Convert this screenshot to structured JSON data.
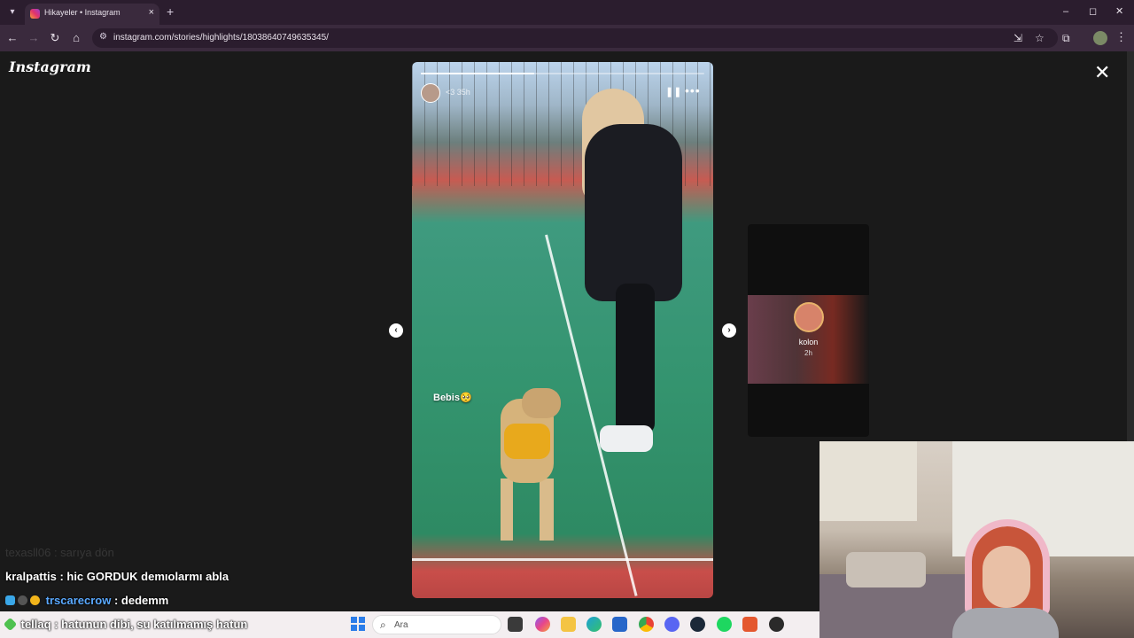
{
  "browser": {
    "tab_title": "Hikayeler • Instagram",
    "tab_close": "×",
    "new_tab": "+",
    "window_controls": {
      "minimize": "–",
      "maximize": "◻",
      "close": "✕"
    },
    "nav": {
      "back": "←",
      "forward": "→",
      "reload": "↻",
      "home": "⌂"
    },
    "url": "instagram.com/stories/highlights/18038640749635345/"
  },
  "page": {
    "logo_text": "Instagram",
    "close": "✕",
    "story": {
      "user_text": "<3  35h",
      "sticker_text": "Bebis🥺",
      "pause": "❚❚",
      "more": "•••",
      "progress": 0.4
    },
    "prev_arrow": "‹",
    "next_arrow": "›",
    "next_preview": {
      "name": "kolon",
      "time": "2h"
    }
  },
  "chat": {
    "lines": [
      {
        "user": "texasll06",
        "message": ": sarıya dön"
      },
      {
        "user": "kralpattis",
        "message": ": hic GORDUK demıolarmı abla"
      },
      {
        "user": "trscarecrow",
        "message": ": dedemm"
      },
      {
        "user": "tellaq",
        "message": ": hatunun dibi, su katılmamış hatun"
      }
    ]
  },
  "taskbar": {
    "search_placeholder": "Ara",
    "search_icon": "⌕"
  },
  "colors": {
    "chrome_dark": "#2b1d2e",
    "chrome_mid": "#3a2a3d",
    "page_bg": "#1a1a1a",
    "chat_username_blue": "#5aa9ff"
  }
}
